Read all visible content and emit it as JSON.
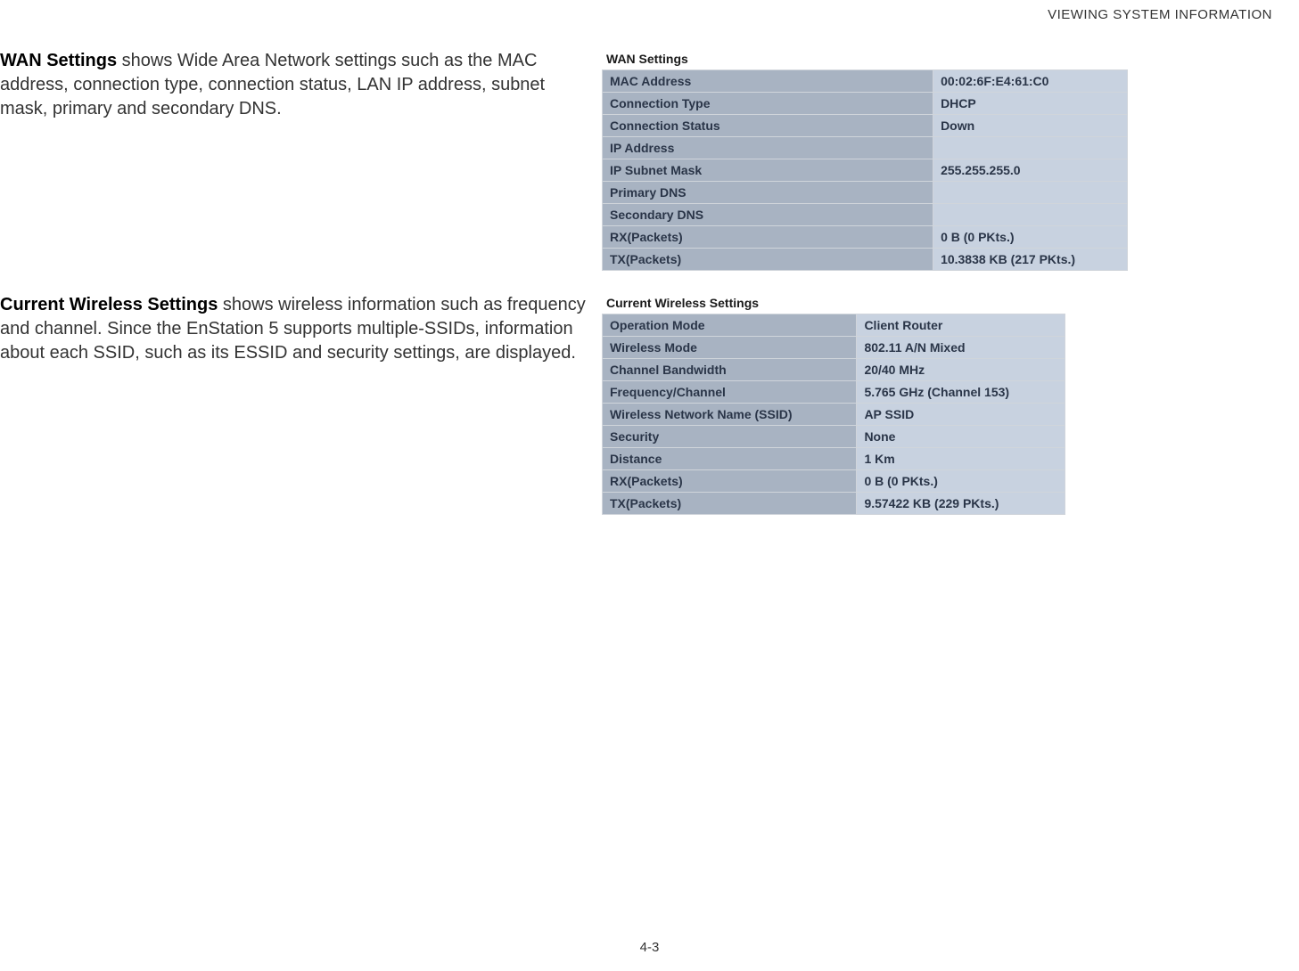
{
  "header": "VIEWING SYSTEM INFORMATION",
  "page_number": "4-3",
  "wan": {
    "title_bold": "WAN Settings",
    "description": "  shows Wide Area Network settings such as the MAC address, connection type, connection status, LAN IP address, subnet mask, primary and secondary DNS.",
    "panel_title": "WAN Settings",
    "rows": [
      {
        "label": "MAC Address",
        "value": "00:02:6F:E4:61:C0"
      },
      {
        "label": "Connection Type",
        "value": "DHCP"
      },
      {
        "label": "Connection Status",
        "value": "Down"
      },
      {
        "label": "IP Address",
        "value": ""
      },
      {
        "label": "IP Subnet Mask",
        "value": "255.255.255.0"
      },
      {
        "label": "Primary DNS",
        "value": ""
      },
      {
        "label": "Secondary DNS",
        "value": ""
      },
      {
        "label": "RX(Packets)",
        "value": "0 B (0 PKts.)"
      },
      {
        "label": "TX(Packets)",
        "value": "10.3838 KB (217 PKts.)"
      }
    ]
  },
  "wireless": {
    "title_bold": "Current Wireless Settings",
    "description": "  shows wireless information such as frequency and channel. Since the EnStation 5 supports multiple-SSIDs, information about each SSID, such as its ESSID and security settings, are displayed.",
    "panel_title": "Current Wireless Settings",
    "rows": [
      {
        "label": "Operation Mode",
        "value": "Client Router"
      },
      {
        "label": "Wireless Mode",
        "value": "802.11 A/N Mixed"
      },
      {
        "label": "Channel Bandwidth",
        "value": "20/40 MHz"
      },
      {
        "label": "Frequency/Channel",
        "value": "5.765 GHz (Channel 153)"
      },
      {
        "label": "Wireless Network Name (SSID)",
        "value": "AP SSID"
      },
      {
        "label": "Security",
        "value": "None"
      },
      {
        "label": "Distance",
        "value": "1 Km"
      },
      {
        "label": "RX(Packets)",
        "value": "0 B (0 PKts.)"
      },
      {
        "label": "TX(Packets)",
        "value": "9.57422 KB (229 PKts.)"
      }
    ]
  }
}
